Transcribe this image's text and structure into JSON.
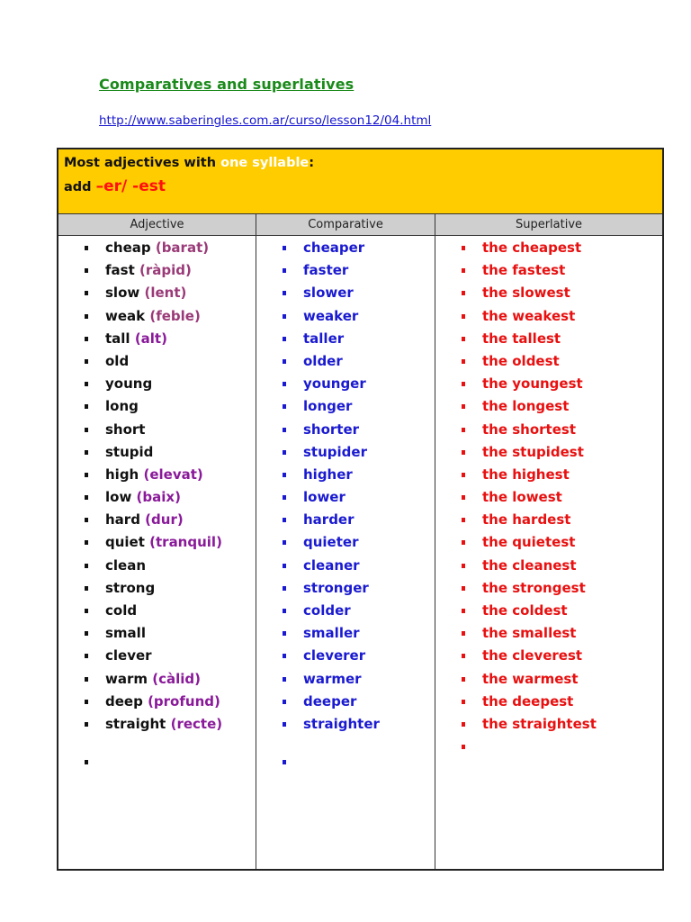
{
  "page": {
    "title": "Comparatives and superlatives",
    "link": "http://www.saberingles.com.ar/curso/lesson12/04.html"
  },
  "banner": {
    "line1_prefix": "Most adjectives with ",
    "line1_highlight": "one syllable",
    "line1_suffix": ":",
    "line2_prefix": "add ",
    "line2_rule": "–er/  -est"
  },
  "colors": {
    "banner_bg": "#ffcc00",
    "header_bg": "#cfcfcf",
    "title": "#1a8a1a",
    "comparative": "#1a1ad0",
    "superlative": "#e81010",
    "translation": "#9a3a78"
  },
  "table": {
    "headers": [
      "Adjective",
      "Comparative",
      "Superlative"
    ],
    "rows": [
      {
        "adjective": "cheap",
        "translation": "(barat)",
        "tone": "mauve",
        "comparative": "cheaper",
        "superlative": "the cheapest"
      },
      {
        "adjective": "fast",
        "translation": "(ràpid)",
        "tone": "mauve",
        "comparative": "faster",
        "superlative": "the fastest"
      },
      {
        "adjective": "slow",
        "translation": "(lent)",
        "tone": "mauve",
        "comparative": "slower",
        "superlative": "the slowest"
      },
      {
        "adjective": "weak",
        "translation": "(feble)",
        "tone": "mauve",
        "comparative": "weaker",
        "superlative": "the weakest"
      },
      {
        "adjective": "tall",
        "translation": "(alt)",
        "tone": "purple",
        "comparative": "taller",
        "superlative": "the tallest"
      },
      {
        "adjective": "old",
        "translation": "",
        "tone": "",
        "comparative": "older",
        "superlative": "the oldest"
      },
      {
        "adjective": "young",
        "translation": "",
        "tone": "",
        "comparative": "younger",
        "superlative": "the youngest"
      },
      {
        "adjective": "long",
        "translation": "",
        "tone": "",
        "comparative": "longer",
        "superlative": "the longest"
      },
      {
        "adjective": "short",
        "translation": "",
        "tone": "",
        "comparative": "shorter",
        "superlative": "the shortest"
      },
      {
        "adjective": "stupid",
        "translation": "",
        "tone": "",
        "comparative": "stupider",
        "superlative": "the stupidest"
      },
      {
        "adjective": "high",
        "translation": "(elevat)",
        "tone": "purple",
        "comparative": "higher",
        "superlative": "the highest"
      },
      {
        "adjective": "low",
        "translation": "(baix)",
        "tone": "purple",
        "comparative": "lower",
        "superlative": "the lowest"
      },
      {
        "adjective": "hard",
        "translation": "(dur)",
        "tone": "purple",
        "comparative": "harder",
        "superlative": "the hardest"
      },
      {
        "adjective": "quiet",
        "translation": "(tranquil)",
        "tone": "purple",
        "comparative": "quieter",
        "superlative": "the quietest"
      },
      {
        "adjective": "clean",
        "translation": "",
        "tone": "",
        "comparative": "cleaner",
        "superlative": "the cleanest"
      },
      {
        "adjective": "strong",
        "translation": "",
        "tone": "",
        "comparative": "stronger",
        "superlative": "the strongest"
      },
      {
        "adjective": "cold",
        "translation": "",
        "tone": "",
        "comparative": "colder",
        "superlative": "the coldest"
      },
      {
        "adjective": "small",
        "translation": "",
        "tone": "",
        "comparative": "smaller",
        "superlative": "the smallest"
      },
      {
        "adjective": "clever",
        "translation": "",
        "tone": "",
        "comparative": "cleverer",
        "superlative": "the cleverest"
      },
      {
        "adjective": "warm",
        "translation": "(càlid)",
        "tone": "purple",
        "comparative": "warmer",
        "superlative": "the warmest"
      },
      {
        "adjective": "deep",
        "translation": "(profund)",
        "tone": "purple",
        "comparative": "deeper",
        "superlative": "the deepest"
      },
      {
        "adjective": "straight",
        "translation": "(recte)",
        "tone": "purple",
        "comparative": "straighter",
        "superlative": "the straightest"
      }
    ],
    "trailing_empty_bullet": true
  }
}
